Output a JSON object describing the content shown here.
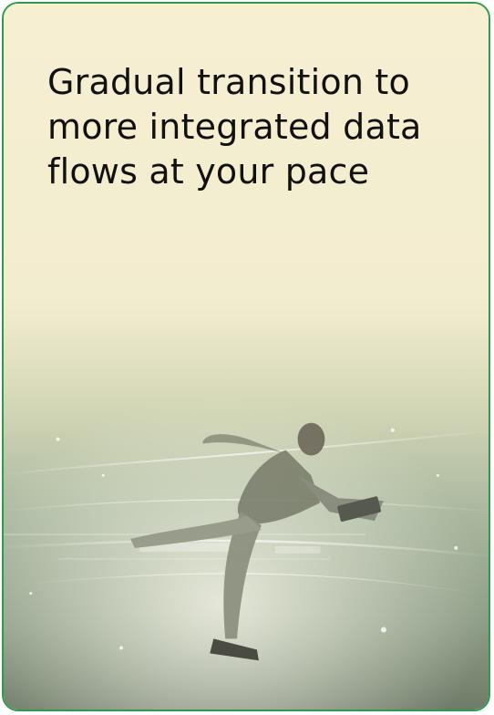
{
  "card": {
    "headline": "Gradual transition to more integrated data flows at your pace",
    "image_subject": "businessman-running-with-laptop-through-data-streams"
  },
  "colors": {
    "card_background": "#f6efd2",
    "card_border": "#2f9a4e",
    "headline_text": "#111111",
    "image_tint": "#9eae94"
  }
}
